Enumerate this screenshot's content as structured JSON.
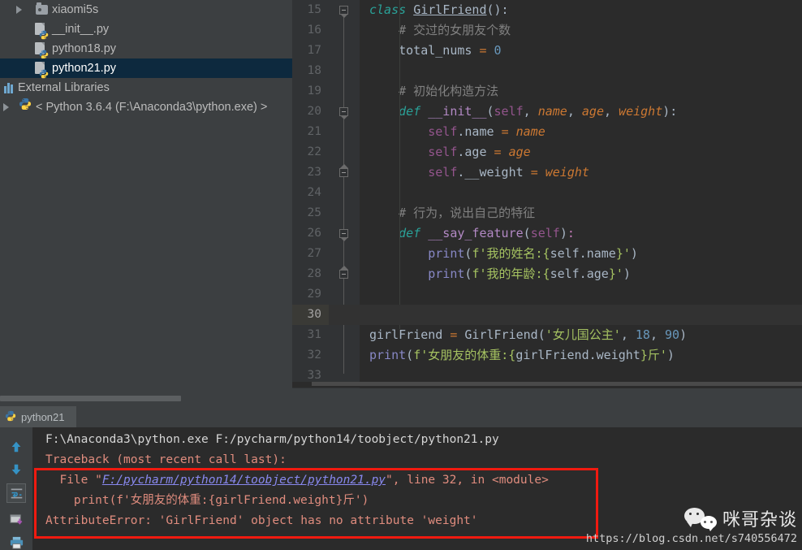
{
  "ide": {
    "name": "PyCharm",
    "theme_bg": "#3c3f41",
    "editor_bg": "#2b2b2b",
    "selection_bg": "#0d293e",
    "error_box_color": "#f01a10"
  },
  "project_tree": {
    "items": [
      {
        "label": "xiaomi5s",
        "icon": "folder-icon",
        "depth": 3,
        "expandable": true,
        "expanded": false,
        "selected": false
      },
      {
        "label": "__init__.py",
        "icon": "python-file-icon",
        "depth": 3,
        "expandable": false,
        "expanded": false,
        "selected": false
      },
      {
        "label": "python18.py",
        "icon": "python-file-icon",
        "depth": 3,
        "expandable": false,
        "expanded": false,
        "selected": false
      },
      {
        "label": "python21.py",
        "icon": "python-file-icon",
        "depth": 3,
        "expandable": false,
        "expanded": false,
        "selected": true
      },
      {
        "label": "External Libraries",
        "icon": "libraries-icon",
        "depth": 1,
        "expandable": false,
        "expanded": false,
        "selected": false
      },
      {
        "label": "< Python 3.6.4 (F:\\Anaconda3\\python.exe) >",
        "icon": "python-logo-icon",
        "depth": 2,
        "expandable": true,
        "expanded": false,
        "selected": false
      }
    ]
  },
  "editor": {
    "current_line": 30,
    "first_visible_line": 15,
    "lines": [
      {
        "n": 15,
        "fold": "start",
        "html": "<span class=\"kw-i\">class</span> <span class=\"cls\">GirlFriend</span><span class=\"op\">():</span>",
        "text": "class GirlFriend():"
      },
      {
        "n": 16,
        "fold": "",
        "html": "    <span class=\"cmt\"># 交过的女朋友个数</span>",
        "text": "    # 交过的女朋友个数"
      },
      {
        "n": 17,
        "fold": "",
        "html": "    total_nums <span class=\"eq\">=</span> <span class=\"num\">0</span>",
        "text": "    total_nums = 0"
      },
      {
        "n": 18,
        "fold": "",
        "html": "",
        "text": ""
      },
      {
        "n": 19,
        "fold": "",
        "html": "    <span class=\"cmt\"># 初始化构造方法</span>",
        "text": "    # 初始化构造方法"
      },
      {
        "n": 20,
        "fold": "start",
        "html": "    <span class=\"kw-i\">def</span> <span class=\"dunder\">__init__</span><span class=\"op\">(</span><span class=\"self\">self</span><span class=\"op\">, </span><span class=\"param\">name</span><span class=\"op\">, </span><span class=\"param\">age</span><span class=\"op\">, </span><span class=\"param\">weight</span><span class=\"op\">):</span>",
        "text": "    def __init__(self, name, age, weight):"
      },
      {
        "n": 21,
        "fold": "",
        "html": "        <span class=\"self\">self</span>.name <span class=\"eq\">=</span> <span class=\"param\">name</span>",
        "text": "        self.name = name"
      },
      {
        "n": 22,
        "fold": "",
        "html": "        <span class=\"self\">self</span>.age <span class=\"eq\">=</span> <span class=\"param\">age</span>",
        "text": "        self.age = age"
      },
      {
        "n": 23,
        "fold": "end",
        "html": "        <span class=\"self\">self</span>.__weight <span class=\"eq\">=</span> <span class=\"param\">weight</span>",
        "text": "        self.__weight = weight"
      },
      {
        "n": 24,
        "fold": "",
        "html": "",
        "text": ""
      },
      {
        "n": 25,
        "fold": "",
        "html": "    <span class=\"cmt\"># 行为，说出自己的特征</span>",
        "text": "    # 行为，说出自己的特征"
      },
      {
        "n": 26,
        "fold": "start",
        "html": "    <span class=\"kw-i\">def</span> <span class=\"dunder\">__say_feature</span><span class=\"op\">(</span><span class=\"self\">self</span><span class=\"op\">)</span><span class=\"pink\">:</span>",
        "text": "    def __say_feature(self):"
      },
      {
        "n": 27,
        "fold": "",
        "html": "        <span class=\"builtin\">print</span><span class=\"op\">(</span><span class=\"str\">f'我的姓名:</span><span class=\"fstr-brace\">{</span>self.name<span class=\"fstr-brace\">}</span><span class=\"str\">'</span><span class=\"op\">)</span>",
        "text": "        print(f'我的姓名:{self.name}')"
      },
      {
        "n": 28,
        "fold": "end",
        "html": "        <span class=\"builtin\">print</span><span class=\"op\">(</span><span class=\"str\">f'我的年龄:</span><span class=\"fstr-brace\">{</span>self.age<span class=\"fstr-brace\">}</span><span class=\"str\">'</span><span class=\"op\">)</span>",
        "text": "        print(f'我的年龄:{self.age}')"
      },
      {
        "n": 29,
        "fold": "",
        "html": "",
        "text": ""
      },
      {
        "n": 30,
        "fold": "",
        "html": "",
        "text": ""
      },
      {
        "n": 31,
        "fold": "",
        "html": "girlFriend <span class=\"eq\">=</span> GirlFriend<span class=\"op\">(</span><span class=\"str\">'女儿国公主'</span><span class=\"op\">, </span><span class=\"num\">18</span><span class=\"op\">, </span><span class=\"num\">90</span><span class=\"op\">)</span>",
        "text": "girlFriend = GirlFriend('女儿国公主', 18, 90)"
      },
      {
        "n": 32,
        "fold": "",
        "html": "<span class=\"builtin\">print</span><span class=\"op\">(</span><span class=\"str\">f'女朋友的体重:</span><span class=\"fstr-brace\">{</span>girlFriend.weight<span class=\"fstr-brace\">}</span><span class=\"str\">斤'</span><span class=\"op\">)</span>",
        "text": "print(f'女朋友的体重:{girlFriend.weight}斤')"
      },
      {
        "n": 33,
        "fold": "",
        "html": "",
        "text": ""
      }
    ]
  },
  "console": {
    "tab_label": "python21",
    "tab_icon": "python-logo-icon",
    "toolbar": [
      {
        "name": "scroll-up-button",
        "icon": "arrow-up-icon"
      },
      {
        "name": "scroll-down-button",
        "icon": "arrow-down-icon"
      },
      {
        "name": "soft-wrap-button",
        "icon": "soft-wrap-icon"
      },
      {
        "name": "export-button",
        "icon": "export-to-file-icon"
      },
      {
        "name": "print-button",
        "icon": "printer-icon"
      }
    ],
    "output": [
      {
        "kind": "cmd",
        "text": "F:\\Anaconda3\\python.exe F:/pycharm/python14/toobject/python21.py"
      },
      {
        "kind": "err",
        "text": "Traceback (most recent call last):"
      },
      {
        "kind": "file",
        "prefix": "  File \"",
        "link": "F:/pycharm/python14/toobject/python21.py",
        "suffix": "\", line 32, in <module>"
      },
      {
        "kind": "err",
        "text": "    print(f'女朋友的体重:{girlFriend.weight}斤')"
      },
      {
        "kind": "err",
        "text": "AttributeError: 'GirlFriend' object has no attribute 'weight'"
      }
    ],
    "highlight_box": {
      "top_line_index": 2,
      "bottom_line_index": 4
    }
  },
  "watermark": {
    "brand": "咪哥杂谈",
    "url": "https://blog.csdn.net/s740556472",
    "icon": "wechat-icon"
  }
}
